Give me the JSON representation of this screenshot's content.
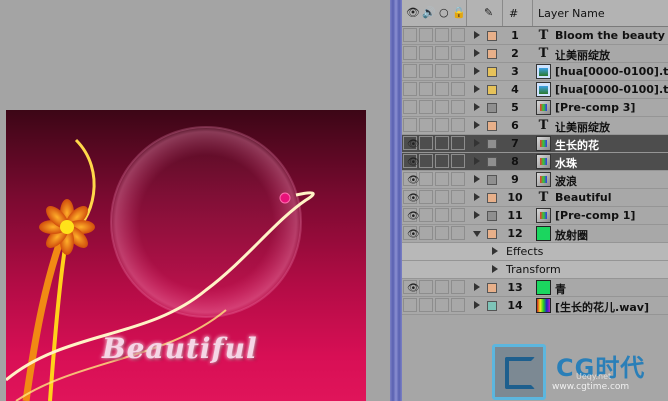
{
  "timeline": {
    "header": {
      "eye_icon": "eye-icon",
      "audio_icon": "speaker-icon",
      "solo_icon": "solo-dot-icon",
      "lock_icon": "lock-icon",
      "label_icon": "label-tag-icon",
      "number_col": "#",
      "name_col": "Layer Name"
    },
    "layers": [
      {
        "num": "1",
        "name": "Bloom the beauty",
        "type": "text",
        "color": "#e8b08a",
        "visible": false,
        "selected": false
      },
      {
        "num": "2",
        "name": "让美丽绽放",
        "type": "text",
        "color": "#e8b08a",
        "visible": false,
        "selected": false
      },
      {
        "num": "3",
        "name": "[hua[0000-0100].t",
        "type": "footage",
        "color": "#e6c25a",
        "visible": false,
        "selected": false
      },
      {
        "num": "4",
        "name": "[hua[0000-0100].t",
        "type": "footage",
        "color": "#e6c25a",
        "visible": false,
        "selected": false
      },
      {
        "num": "5",
        "name": "[Pre-comp 3]",
        "type": "comp",
        "color": "#8f8f8f",
        "visible": false,
        "selected": false
      },
      {
        "num": "6",
        "name": "让美丽绽放",
        "type": "text",
        "color": "#e8b08a",
        "visible": false,
        "selected": false
      },
      {
        "num": "7",
        "name": "生长的花",
        "type": "comp",
        "color": "#8f8f8f",
        "visible": true,
        "selected": true
      },
      {
        "num": "8",
        "name": "水珠",
        "type": "comp",
        "color": "#8f8f8f",
        "visible": true,
        "selected": true
      },
      {
        "num": "9",
        "name": "波浪",
        "type": "comp",
        "color": "#8f8f8f",
        "visible": true,
        "selected": false
      },
      {
        "num": "10",
        "name": "Beautiful",
        "type": "text",
        "color": "#e8b08a",
        "visible": true,
        "selected": false
      },
      {
        "num": "11",
        "name": "[Pre-comp 1]",
        "type": "comp",
        "color": "#8f8f8f",
        "visible": true,
        "selected": false
      },
      {
        "num": "12",
        "name": "放射圈",
        "type": "solid",
        "color": "#e8b08a",
        "visible": true,
        "selected": false,
        "expanded": true
      }
    ],
    "sub_items": [
      "Effects",
      "Transform"
    ],
    "layers_after": [
      {
        "num": "13",
        "name": "青",
        "type": "solid",
        "color": "#e8b08a",
        "visible": true,
        "selected": false
      },
      {
        "num": "14",
        "name": "[生长的花儿.wav]",
        "type": "audio",
        "color": "#7ec4b8",
        "visible": false,
        "selected": false
      }
    ]
  },
  "canvas": {
    "word": "Beautiful"
  },
  "watermark": {
    "title": "CG时代",
    "site": "Ueqy.net",
    "url": "www.cgtime.com"
  }
}
